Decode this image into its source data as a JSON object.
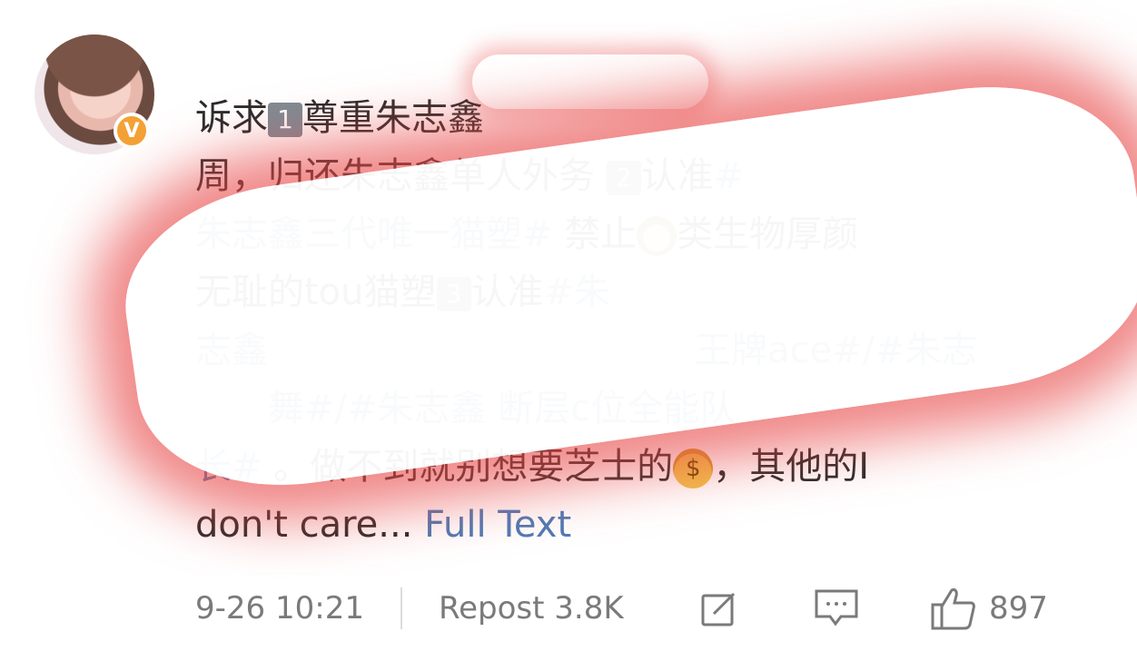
{
  "post": {
    "line1": "诉求",
    "line1_num": "1",
    "line1_rest": "尊重朱志鑫",
    "line2_pre": "周",
    "line2": "，归还朱志鑫单人外务",
    "line2_num": "2",
    "line2_tail": "认准",
    "line2_tag": "#",
    "line3_tag": "朱志鑫三代唯一猫塑#",
    "line3_text": " 禁止",
    "line3_text2": "类生物厚颜",
    "line4_text": "无耻的tou猫塑",
    "line4_num": "3",
    "line4_text2": "认准",
    "line4_tag": "#朱",
    "line5_tag": "志鑫",
    "line5_tag2": "王牌ace#/#朱志",
    "line6_tag": "舞#/#朱志鑫 断层c位全能队",
    "line7_tag": "长#",
    "line7_text": " 。做不到就别想要芝士的",
    "line7_text2": "，其他的I",
    "line8_text": "don't care...",
    "line8_more": " Full Text"
  },
  "footer": {
    "time": "9-26 10:21",
    "repost": "Repost 3.8K",
    "likes": "897"
  },
  "icons": {
    "verified": "verified-v-badge",
    "edit": "edit-icon",
    "comment": "comment-icon",
    "like": "thumbs-up-icon"
  },
  "colors": {
    "tag": "#5b7fb5",
    "badge": "#f3a235",
    "scribble_glow": "#e84646"
  }
}
